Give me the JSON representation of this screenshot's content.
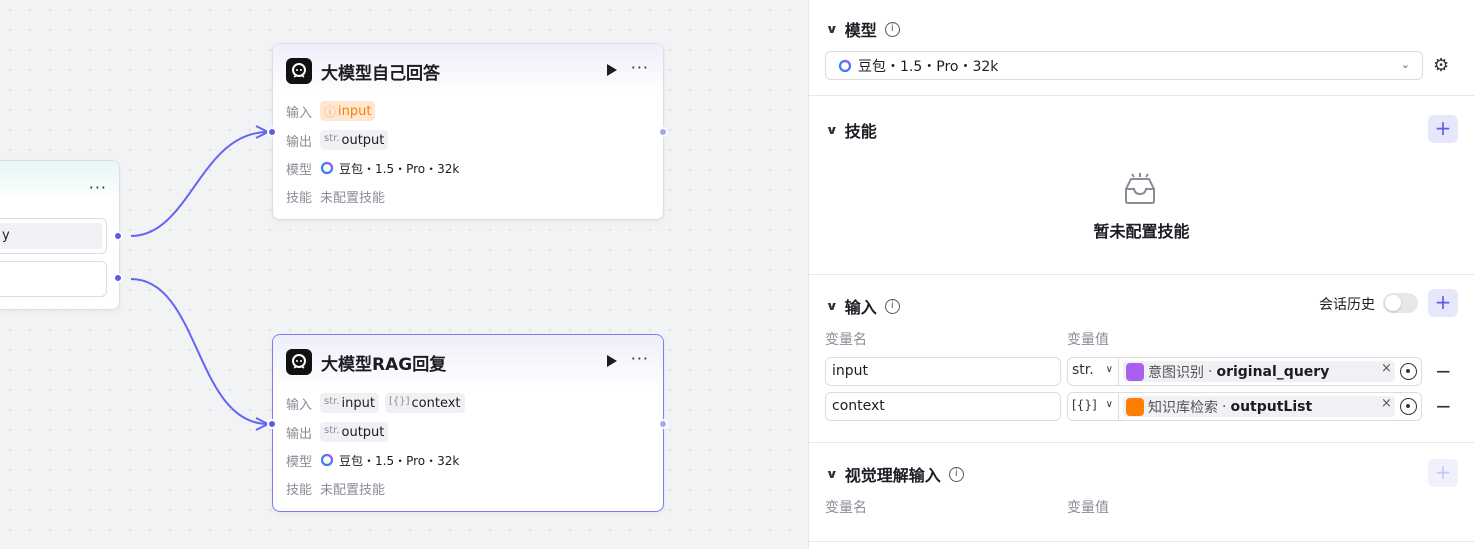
{
  "colors": {
    "accent": "#5b5de6",
    "warning": "#ff7d00",
    "intent_icon": "#a960ee",
    "kb_icon": "#ff7d00"
  },
  "left_node": {
    "more": "···",
    "field1_text": "y"
  },
  "node1": {
    "title": "大模型自己回答",
    "run_icon": "play-icon",
    "more": "···",
    "input_label": "输入",
    "input_tag": "input",
    "input_tag_icon": "warning-icon",
    "output_label": "输出",
    "output_type": "str.",
    "output_tag": "output",
    "model_label": "模型",
    "model_value": "豆包・1.5・Pro・32k",
    "skill_label": "技能",
    "skill_value": "未配置技能"
  },
  "node2": {
    "title": "大模型RAG回复",
    "run_icon": "play-icon",
    "more": "···",
    "input_label": "输入",
    "input_type": "str.",
    "input_tag": "input",
    "context_type": "[{}]",
    "context_tag": "context",
    "output_label": "输出",
    "output_type": "str.",
    "output_tag": "output",
    "model_label": "模型",
    "model_value": "豆包・1.5・Pro・32k",
    "skill_label": "技能",
    "skill_value": "未配置技能"
  },
  "panel": {
    "model": {
      "title": "模型",
      "info": "i",
      "selected": "豆包・1.5・Pro・32k",
      "caret": "⌄",
      "settings_icon": "gear-icon"
    },
    "skills": {
      "title": "技能",
      "add": "+",
      "empty_text": "暂未配置技能"
    },
    "inputs": {
      "title": "输入",
      "info": "i",
      "history_label": "会话历史",
      "history_enabled": false,
      "add": "+",
      "col_name": "变量名",
      "col_value": "变量值",
      "rows": [
        {
          "name": "input",
          "type": "str.",
          "source_node": "意图识别",
          "separator": "·",
          "source_field": "original_query",
          "remove": "×",
          "minus": "−"
        },
        {
          "name": "context",
          "type": "[{}]",
          "source_node": "知识库检索",
          "separator": "·",
          "source_field": "outputList",
          "remove": "×",
          "minus": "−"
        }
      ]
    },
    "vision": {
      "title": "视觉理解输入",
      "info": "i",
      "add": "+",
      "col_name": "变量名",
      "col_value": "变量值"
    }
  }
}
